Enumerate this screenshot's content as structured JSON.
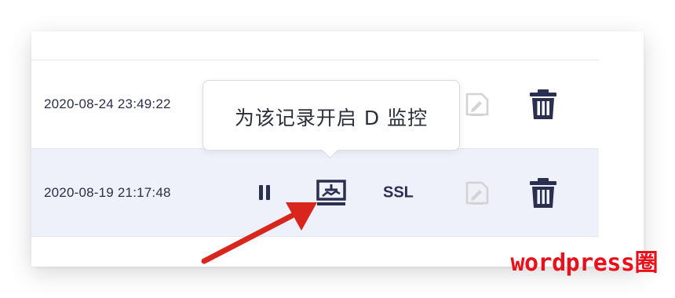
{
  "rows": [
    {
      "timestamp": "2020-08-24 23:49:22"
    },
    {
      "timestamp": "2020-08-19 21:17:48"
    }
  ],
  "actions": {
    "ssl_label": "SSL",
    "pause_icon": "pause-icon",
    "monitor_icon": "monitor-icon",
    "edit_icon": "edit-icon",
    "delete_icon": "trash-icon"
  },
  "tooltip": {
    "text": "为该记录开启 D 监控"
  },
  "watermark": {
    "text": "wordpress圈"
  },
  "colors": {
    "icon_dark": "#2b3050",
    "icon_disabled": "#d3d3d3",
    "row_highlight": "#eef0fa",
    "annotation_arrow": "#d9261c",
    "watermark": "#e8111b"
  }
}
